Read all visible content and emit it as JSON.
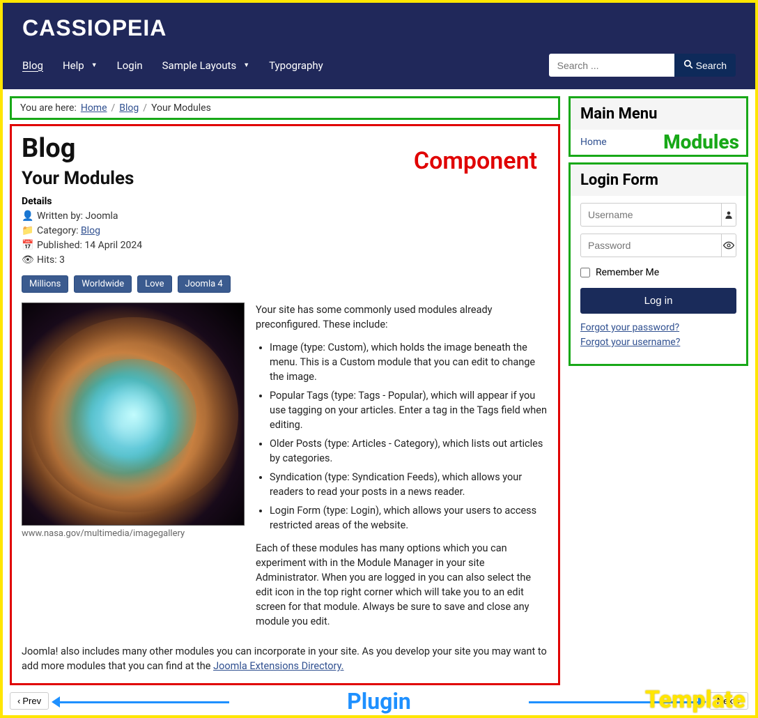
{
  "brand": "CASSIOPEIA",
  "nav": {
    "blog": "Blog",
    "help": "Help",
    "login": "Login",
    "sample_layouts": "Sample Layouts",
    "typography": "Typography"
  },
  "search": {
    "placeholder": "Search ...",
    "button": "Search"
  },
  "breadcrumb": {
    "prefix": "You are here:",
    "home": "Home",
    "blog": "Blog",
    "current": "Your Modules"
  },
  "overlay": {
    "component": "Component",
    "modules": "Modules",
    "plugin": "Plugin",
    "template": "Template"
  },
  "article": {
    "section": "Blog",
    "title": "Your Modules",
    "details_label": "Details",
    "written_by_label": "Written by:",
    "author": "Joomla",
    "category_label": "Category:",
    "category": "Blog",
    "published_label": "Published:",
    "published": "14 April 2024",
    "hits_label": "Hits:",
    "hits": "3",
    "tags": [
      "Millions",
      "Worldwide",
      "Love",
      "Joomla 4"
    ],
    "image_caption": "www.nasa.gov/multimedia/imagegallery",
    "intro": "Your site has some commonly used modules already preconfigured. These include:",
    "bullets": [
      "Image (type: Custom), which holds the image beneath the menu. This is a Custom module that you can edit to change the image.",
      "Popular Tags (type: Tags - Popular), which will appear if you use tagging on your articles. Enter a tag in the Tags field when editing.",
      "Older Posts (type: Articles - Category), which lists out articles by categories.",
      "Syndication (type: Syndication Feeds), which allows your readers to read your posts in a news reader.",
      "Login Form (type: Login), which allows your users to access restricted areas of the website."
    ],
    "closing": "Each of these modules has many options which you can experiment with in the Module Manager in your site Administrator. When you are logged in you can also select the edit icon in the top right corner which will take you to an edit screen for that module. Always be sure to save and close any module you edit.",
    "outro_prefix": "Joomla! also includes many other modules you can incorporate in your site. As you develop your site you may want to add more modules that you can find at the ",
    "jed_link": "Joomla Extensions Directory."
  },
  "pager": {
    "prev": "Prev",
    "next": "Next"
  },
  "sidebar": {
    "main_menu_title": "Main Menu",
    "main_menu_home": "Home",
    "login_form_title": "Login Form",
    "username_placeholder": "Username",
    "password_placeholder": "Password",
    "remember_me": "Remember Me",
    "login_btn": "Log in",
    "forgot_password": "Forgot your password?",
    "forgot_username": "Forgot your username?"
  }
}
